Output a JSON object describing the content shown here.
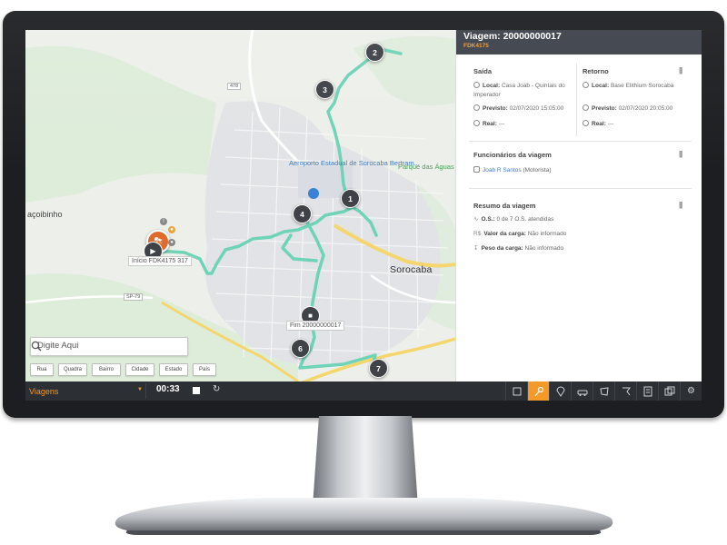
{
  "trip": {
    "title": "Viagem: 20000000017",
    "plate": "FDK4175"
  },
  "departure": {
    "heading": "Saída",
    "local_label": "Local:",
    "local_value": "Casa Joab - Quintais do Imperador",
    "planned_label": "Previsto:",
    "planned_value": "02/07/2020 15:05:00",
    "real_label": "Real:",
    "real_value": "---"
  },
  "return": {
    "heading": "Retorno",
    "local_label": "Local:",
    "local_value": "Base Elithium Sorocaba",
    "planned_label": "Previsto:",
    "planned_value": "02/07/2020 20:05:00",
    "real_label": "Real:",
    "real_value": "---"
  },
  "employees": {
    "heading": "Funcionários da viagem",
    "name": "Joab R Santos",
    "role": "(Motorista)"
  },
  "summary": {
    "heading": "Resumo da viagem",
    "os_label": "O.S.:",
    "os_value": "0 de 7 O.S. atendidas",
    "value_label": "Valor da carga:",
    "value_value": "Não informado",
    "weight_label": "Peso da carga:",
    "weight_value": "Não informado"
  },
  "map": {
    "labels": {
      "airport": "Aeroporto Estadual de Sorocaba Bertram...",
      "park": "Parque das Águas",
      "city": "Sorocaba",
      "west": "açoibinho",
      "route_sp": "SP-79",
      "route_478": "478"
    },
    "markers": [
      "1",
      "2",
      "3",
      "4",
      "6",
      "7"
    ],
    "start_tip": "Início FDK4175 317",
    "end_tip": "Fim 20000000017"
  },
  "search": {
    "placeholder": "Digite Aqui"
  },
  "filters": [
    "Rua",
    "Quadra",
    "Bairro",
    "Cidade",
    "Estado",
    "País"
  ],
  "bottombar": {
    "module": "Viagens",
    "timer": "00:33"
  },
  "colors": {
    "route": "#6fd3b7",
    "accent": "#f39a2b",
    "panel_header": "#3d414a",
    "bottombar": "#2c2f34"
  }
}
